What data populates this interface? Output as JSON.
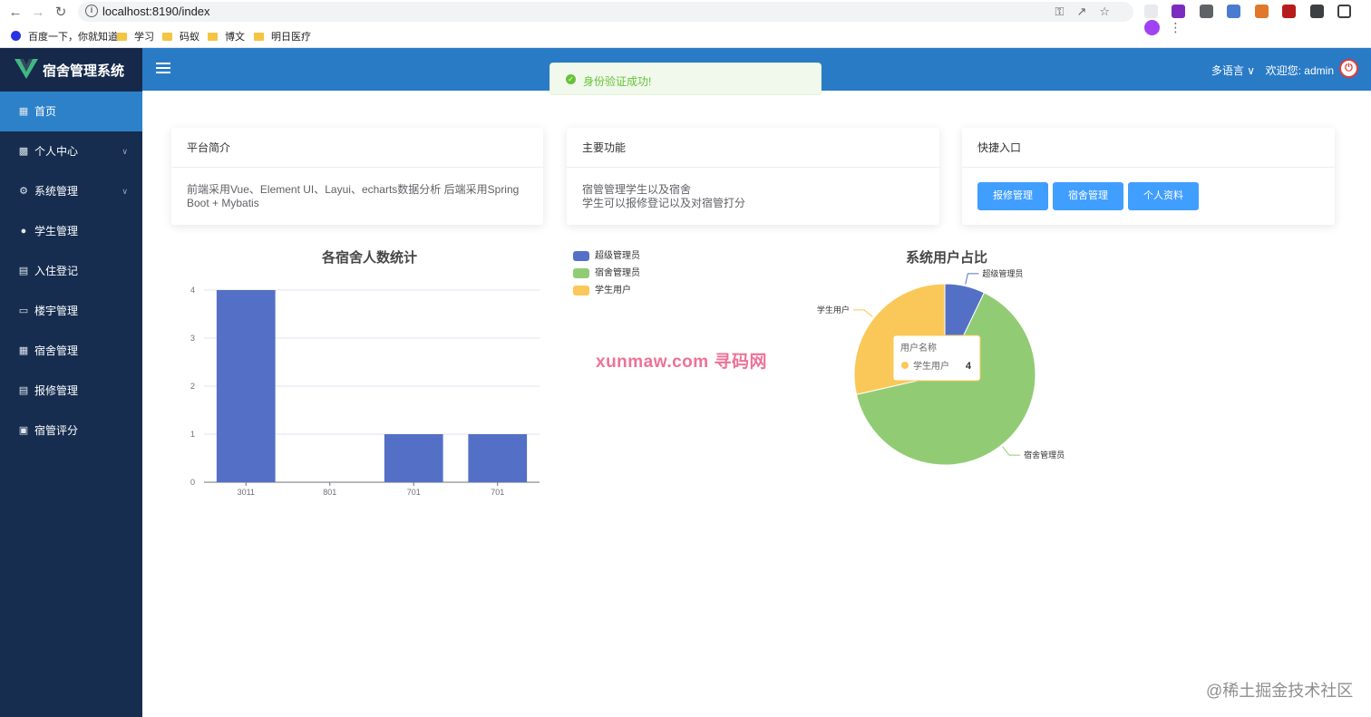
{
  "browser": {
    "url": "localhost:8190/index",
    "bookmarks": [
      "百度一下，你就知道",
      "学习",
      "码蚁",
      "博文",
      "明日医疗"
    ]
  },
  "app": {
    "title": "宿舍管理系统"
  },
  "sidebar": {
    "items": [
      {
        "label": "首页",
        "icon": "grid-icon",
        "active": true,
        "has_children": false
      },
      {
        "label": "个人中心",
        "icon": "briefcase-icon",
        "active": false,
        "has_children": true
      },
      {
        "label": "系统管理",
        "icon": "gear-icon",
        "active": false,
        "has_children": true
      },
      {
        "label": "学生管理",
        "icon": "user-icon",
        "active": false,
        "has_children": false
      },
      {
        "label": "入住登记",
        "icon": "clipboard-icon",
        "active": false,
        "has_children": false
      },
      {
        "label": "楼宇管理",
        "icon": "bar-chart-icon",
        "active": false,
        "has_children": false
      },
      {
        "label": "宿舍管理",
        "icon": "apps-icon",
        "active": false,
        "has_children": false
      },
      {
        "label": "报修管理",
        "icon": "document-icon",
        "active": false,
        "has_children": false
      },
      {
        "label": "宿管评分",
        "icon": "rating-icon",
        "active": false,
        "has_children": false
      }
    ]
  },
  "header": {
    "language": "多语言",
    "welcome": "欢迎您: admin"
  },
  "toast": {
    "message": "身份验证成功!"
  },
  "cards": {
    "intro": {
      "title": "平台简介",
      "body": "前端采用Vue、Element UI、Layui、echarts数据分析 后端采用Spring Boot + Mybatis"
    },
    "features": {
      "title": "主要功能",
      "lines": [
        "宿管管理学生以及宿舍",
        "学生可以报修登记以及对宿管打分"
      ]
    },
    "shortcuts": {
      "title": "快捷入口",
      "buttons": [
        "报修管理",
        "宿舍管理",
        "个人资料"
      ]
    }
  },
  "colors": {
    "sidebar": "#162d50",
    "topbar": "#2a7bc6",
    "active": "#2d81c9",
    "primary": "#409eff",
    "bar": "#5470c6",
    "series": [
      "#5470c6",
      "#91cc75",
      "#fac858"
    ]
  },
  "watermark": "xunmaw.com 寻码网",
  "footer_mark": "@稀土掘金技术社区",
  "chart_data": [
    {
      "type": "bar",
      "title": "各宿舍人数统计",
      "categories": [
        "3011",
        "801",
        "701",
        "701"
      ],
      "values": [
        4,
        0,
        1,
        1
      ],
      "ylim": [
        0,
        4
      ],
      "yticks": [
        0,
        1,
        2,
        3,
        4
      ],
      "grid": true
    },
    {
      "type": "pie",
      "title": "系统用户占比",
      "legend_position": "top-left",
      "slices": [
        {
          "name": "超级管理员",
          "value": 1
        },
        {
          "name": "宿舍管理员",
          "value": 9
        },
        {
          "name": "学生用户",
          "value": 4
        }
      ],
      "tooltip": {
        "title": "用户名称",
        "name": "学生用户",
        "value": 4
      }
    }
  ]
}
